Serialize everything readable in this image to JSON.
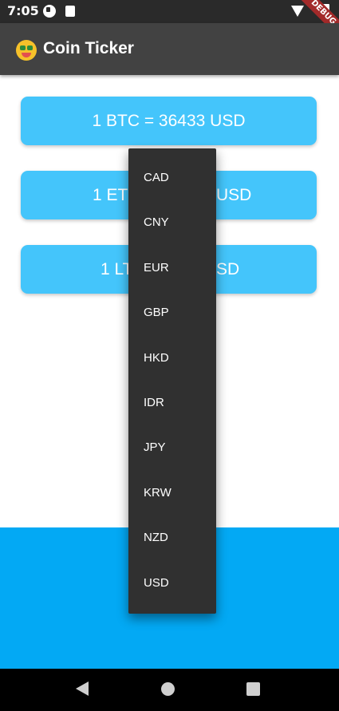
{
  "status_bar": {
    "time": "7:05",
    "debug_label": "DEBUG",
    "icons": [
      "status-circle-icon",
      "sd-card-icon",
      "wifi-icon",
      "battery-icon"
    ]
  },
  "app_bar": {
    "emoji_icon": "money-mouth-face-icon",
    "title": "Coin Ticker",
    "background": "#424242"
  },
  "rates": [
    {
      "left": "1 BTC = 36433 USD"
    },
    {
      "left": "1 ET",
      "right": "USD"
    },
    {
      "left": "1 LT",
      "right": "SD"
    }
  ],
  "colors": {
    "card": "#44c5fb",
    "bottom_panel": "#03a9f4",
    "menu": "#303030"
  },
  "currency_menu": {
    "items": [
      "CAD",
      "CNY",
      "EUR",
      "GBP",
      "HKD",
      "IDR",
      "JPY",
      "KRW",
      "NZD",
      "USD"
    ]
  },
  "nav_bar": {
    "icons": [
      "back-icon",
      "home-icon",
      "recents-icon"
    ]
  }
}
